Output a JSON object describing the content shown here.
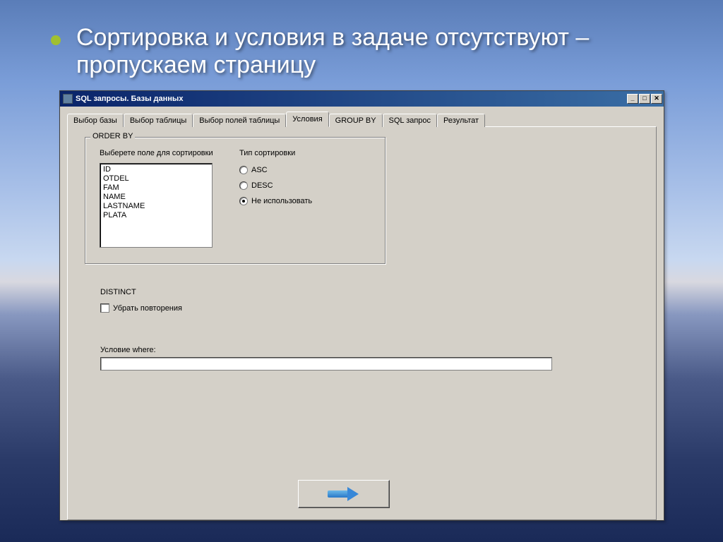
{
  "slide": {
    "text": "Сортировка и условия в задаче отсутствуют – пропускаем страницу"
  },
  "window": {
    "title": "SQL запросы. Базы данных",
    "tabs": [
      {
        "label": "Выбор базы"
      },
      {
        "label": "Выбор таблицы"
      },
      {
        "label": "Выбор полей таблицы"
      },
      {
        "label": "Условия"
      },
      {
        "label": "GROUP BY"
      },
      {
        "label": "SQL запрос"
      },
      {
        "label": "Результат"
      }
    ],
    "active_tab_index": 3,
    "orderby": {
      "title": "ORDER BY",
      "field_label": "Выберете поле для сортировки",
      "fields": [
        "ID",
        "OTDEL",
        "FAM",
        "NAME",
        "LASTNAME",
        "PLATA"
      ],
      "sort_type_label": "Тип сортировки",
      "radios": [
        {
          "label": "ASC",
          "checked": false
        },
        {
          "label": "DESC",
          "checked": false
        },
        {
          "label": "Не использовать",
          "checked": true
        }
      ]
    },
    "distinct": {
      "title": "DISTINCT",
      "checkbox_label": "Убрать повторения",
      "checked": false
    },
    "where": {
      "label": "Условие where:",
      "value": ""
    }
  }
}
